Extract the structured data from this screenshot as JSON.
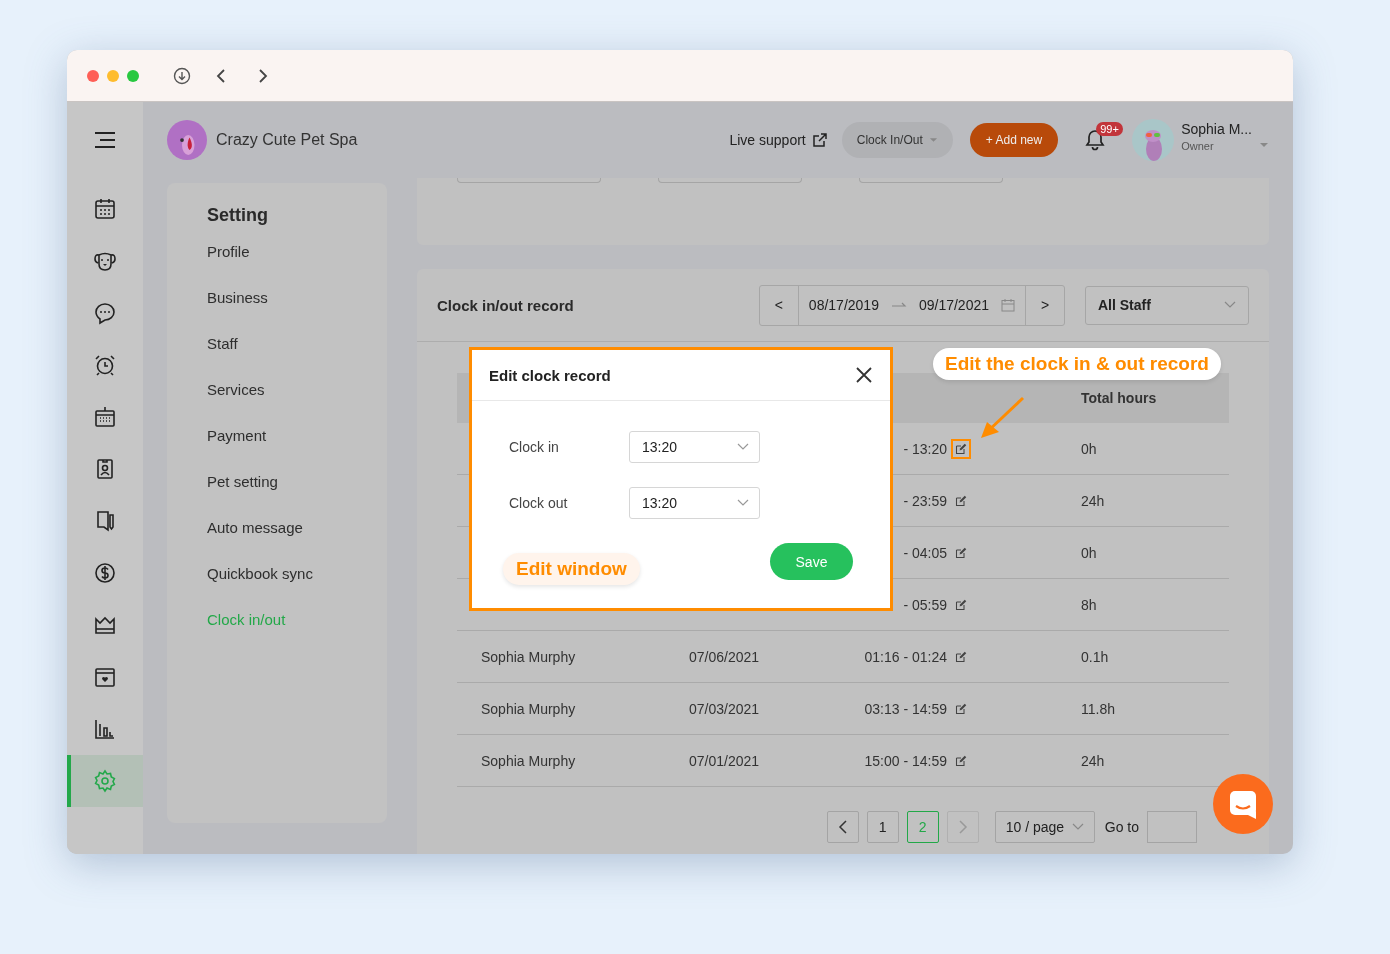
{
  "sidebar": {
    "items": [
      {
        "selected": false
      },
      {
        "selected": false
      },
      {
        "selected": false
      },
      {
        "selected": false
      },
      {
        "selected": false
      },
      {
        "selected": false
      },
      {
        "selected": false
      },
      {
        "selected": false
      },
      {
        "selected": false
      },
      {
        "selected": false
      },
      {
        "selected": false
      },
      {
        "selected": true
      }
    ]
  },
  "header": {
    "business_name": "Crazy Cute Pet Spa",
    "live_support": "Live support",
    "clock_button": "Clock In/Out",
    "add_button": "+ Add new",
    "notification_badge": "99+",
    "user": {
      "name": "Sophia M...",
      "role": "Owner"
    }
  },
  "settings_menu": {
    "title": "Setting",
    "items": [
      {
        "label": "Profile",
        "selected": false
      },
      {
        "label": "Business",
        "selected": false
      },
      {
        "label": "Staff",
        "selected": false
      },
      {
        "label": "Services",
        "selected": false
      },
      {
        "label": "Payment",
        "selected": false
      },
      {
        "label": "Pet setting",
        "selected": false
      },
      {
        "label": "Auto message",
        "selected": false
      },
      {
        "label": "Quickbook sync",
        "selected": false
      },
      {
        "label": "Clock in/out",
        "selected": true
      }
    ]
  },
  "record_card": {
    "title": "Clock in/out record",
    "prev": "<",
    "start_date": "08/17/2019",
    "end_date": "09/17/2021",
    "next": ">",
    "staff_filter": "All Staff",
    "table": {
      "columns": [
        "Total hours"
      ],
      "rows": [
        {
          "time": "- 13:20",
          "total": "0h",
          "highlighted": true
        },
        {
          "time": "- 23:59",
          "total": "24h",
          "highlighted": false
        },
        {
          "time": "- 04:05",
          "total": "0h",
          "highlighted": false
        },
        {
          "time": "- 05:59",
          "total": "8h",
          "highlighted": false
        },
        {
          "name": "Sophia Murphy",
          "date": "07/06/2021",
          "time": "01:16 - 01:24",
          "total": "0.1h",
          "highlighted": false
        },
        {
          "name": "Sophia Murphy",
          "date": "07/03/2021",
          "time": "03:13 - 14:59",
          "total": "11.8h",
          "highlighted": false
        },
        {
          "name": "Sophia Murphy",
          "date": "07/01/2021",
          "time": "15:00 - 14:59",
          "total": "24h",
          "highlighted": false
        }
      ]
    },
    "pagination": {
      "pages": [
        {
          "label": "1",
          "selected": false
        },
        {
          "label": "2",
          "selected": true
        }
      ],
      "next_disabled": true,
      "page_size": "10 / page",
      "goto_label": "Go to"
    }
  },
  "modal": {
    "title": "Edit clock record",
    "fields": [
      {
        "label": "Clock in",
        "value": "13:20"
      },
      {
        "label": "Clock out",
        "value": "13:20"
      }
    ],
    "save": "Save",
    "callout": "Edit window"
  },
  "row_callout": "Edit the clock in & out record"
}
